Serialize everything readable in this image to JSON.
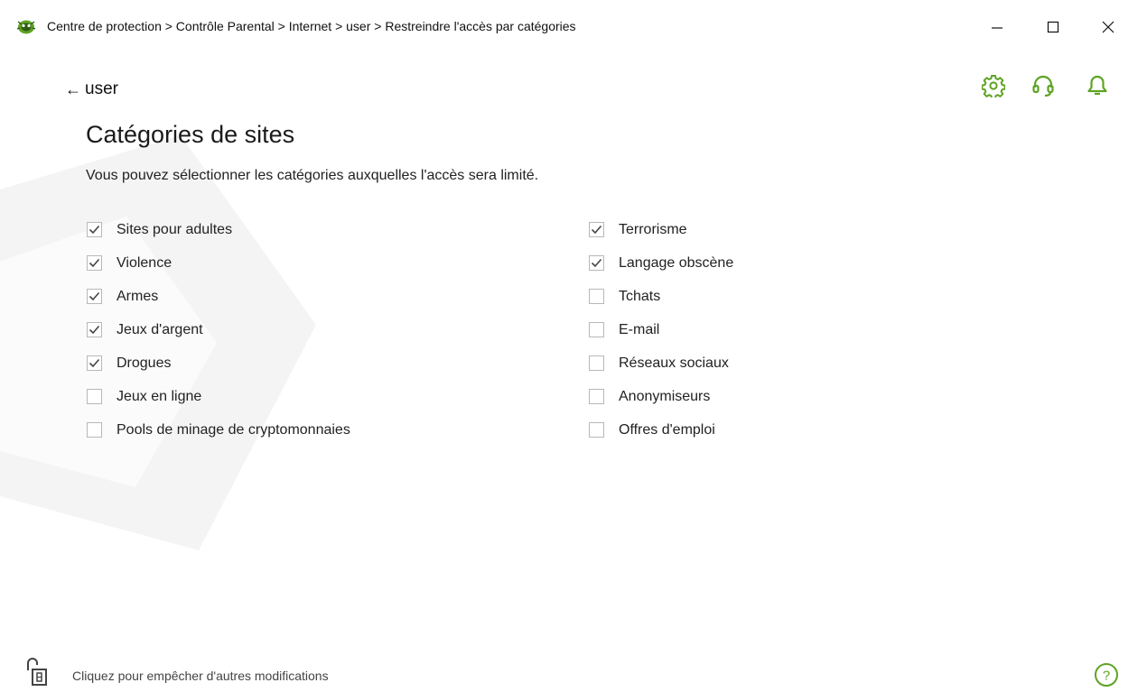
{
  "window": {
    "title": "Centre de protection > Contrôle Parental > Internet > user > Restreindre l'accès par catégories"
  },
  "nav": {
    "back_label": "user"
  },
  "page": {
    "title": "Catégories de sites",
    "subtitle": "Vous pouvez sélectionner les catégories auxquelles l'accès sera limité."
  },
  "categories_left": [
    {
      "label": "Sites pour adultes",
      "checked": true
    },
    {
      "label": "Violence",
      "checked": true
    },
    {
      "label": "Armes",
      "checked": true
    },
    {
      "label": "Jeux d'argent",
      "checked": true
    },
    {
      "label": "Drogues",
      "checked": true
    },
    {
      "label": "Jeux en ligne",
      "checked": false
    },
    {
      "label": "Pools de minage de cryptomonnaies",
      "checked": false
    }
  ],
  "categories_right": [
    {
      "label": "Terrorisme",
      "checked": true
    },
    {
      "label": "Langage obscène",
      "checked": true
    },
    {
      "label": "Tchats",
      "checked": false
    },
    {
      "label": "E-mail",
      "checked": false
    },
    {
      "label": "Réseaux sociaux",
      "checked": false
    },
    {
      "label": "Anonymiseurs",
      "checked": false
    },
    {
      "label": "Offres d'emploi",
      "checked": false
    }
  ],
  "footer": {
    "lock_text": "Cliquez pour empêcher d'autres modifications"
  },
  "icons": {
    "app": "drweb-spider-icon",
    "minimize": "minimize-icon",
    "maximize": "maximize-icon",
    "close": "close-icon",
    "gear": "gear-icon",
    "support": "headset-icon",
    "bell": "bell-icon",
    "lock": "open-lock-icon",
    "help": "help-icon"
  },
  "colors": {
    "accent": "#5fa324",
    "checkmark": "#444444",
    "watermark": "#f3f3f3"
  }
}
